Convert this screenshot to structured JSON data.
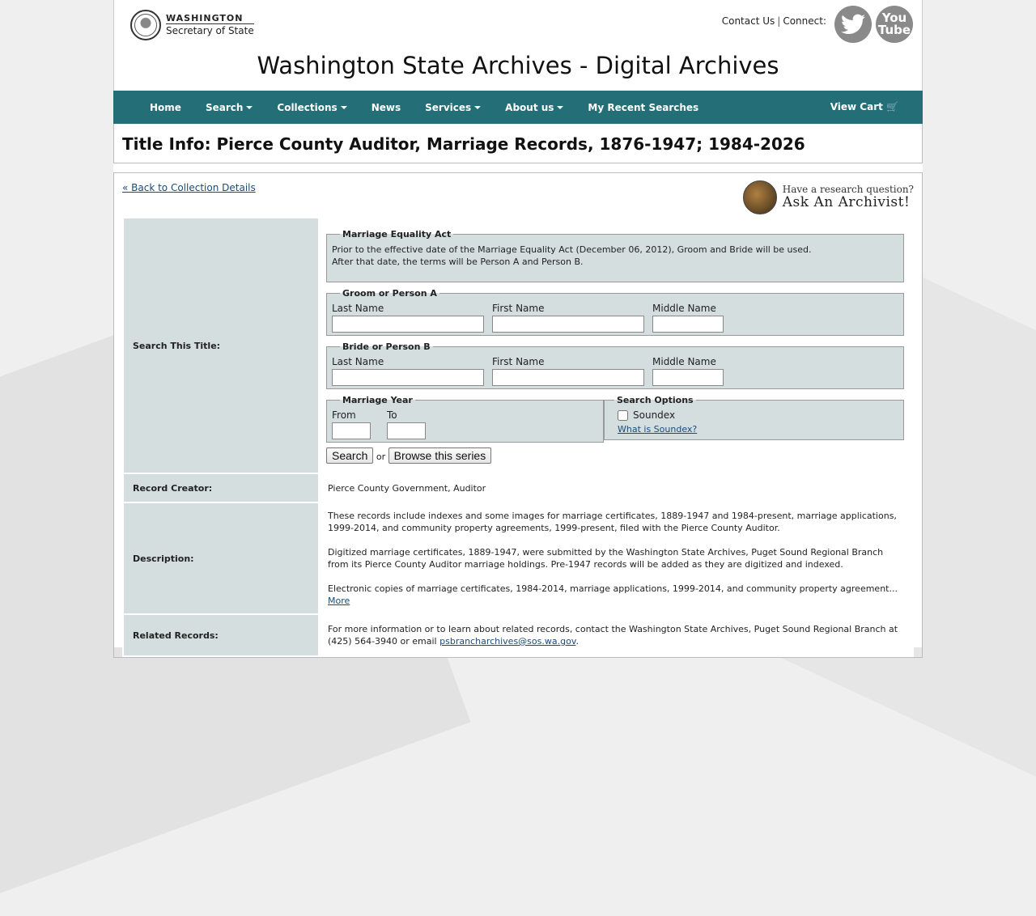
{
  "header": {
    "logo_line1": "WASHINGTON",
    "logo_line2": "Secretary of State",
    "contact": "Contact Us",
    "connect": "Connect:",
    "youtube_l1": "You",
    "youtube_l2": "Tube",
    "site_title": "Washington State Archives - Digital Archives"
  },
  "nav": {
    "items": [
      "Home",
      "Search",
      "Collections",
      "News",
      "Services",
      "About us",
      "My Recent Searches"
    ],
    "cart": "View Cart"
  },
  "page_title": "Title Info: Pierce County Auditor, Marriage Records, 1876-1947; 1984-2026",
  "back_link": "« Back to Collection Details",
  "ask": {
    "line1": "Have a research question?",
    "line2": "Ask An Archivist!"
  },
  "search": {
    "label": "Search This Title:",
    "equality_legend": "Marriage Equality Act",
    "equality_text": "Prior to the effective date of the Marriage Equality Act (December 06, 2012), Groom and Bride will be used. After that date, the terms will be Person A and Person B.",
    "groom_legend": "Groom or Person A",
    "bride_legend": "Bride or Person B",
    "last_name": "Last Name",
    "first_name": "First Name",
    "middle_name": "Middle Name",
    "year_legend": "Marriage Year",
    "from": "From",
    "to": "To",
    "options_legend": "Search Options",
    "soundex": "Soundex",
    "what_soundex": "What is Soundex?",
    "search_btn": "Search",
    "or": "or",
    "browse_btn": "Browse this series"
  },
  "record_creator": {
    "label": "Record Creator:",
    "value": "Pierce County Government, Auditor"
  },
  "description": {
    "label": "Description:",
    "p1": "These records include indexes and some images for marriage certificates, 1889-1947 and 1984-present, marriage applications, 1999-2014, and community property agreements, 1999-present, filed with the Pierce County Auditor.",
    "p2": "Digitized marriage certificates, 1889-1947, were submitted by the Washington State Archives, Puget Sound Regional Branch from its Pierce County Auditor marriage holdings. Pre-1947 records will be added as they are digitized and indexed.",
    "p3": "Electronic copies of marriage certificates, 1984-2014, marriage applications, 1999-2014, and community property agreement...",
    "more": "More"
  },
  "related": {
    "label": "Related Records:",
    "text": "For more information or to learn about related records, contact the Washington State Archives, Puget Sound Regional Branch at (425) 564-3940 or email ",
    "email": "psbrancharchives@sos.wa.gov",
    "end": "."
  }
}
